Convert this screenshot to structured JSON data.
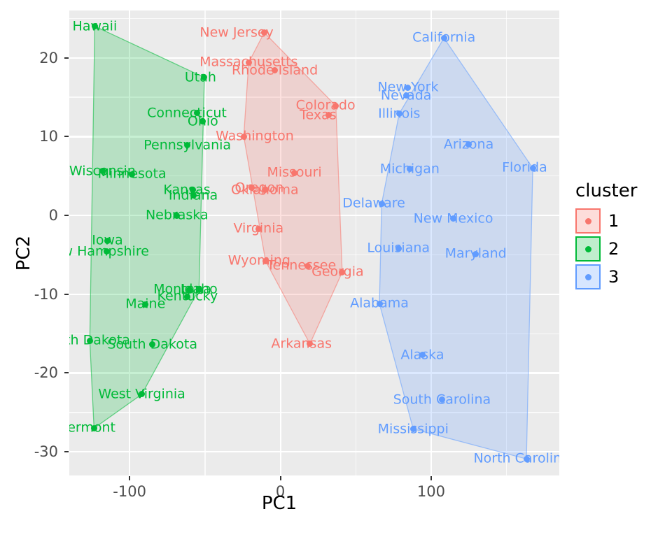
{
  "chart_data": {
    "type": "scatter",
    "title": "",
    "xlabel": "PC1",
    "ylabel": "PC2",
    "xlim": [
      -140,
      185
    ],
    "ylim": [
      -33,
      26
    ],
    "xticks": [
      "-100",
      "0",
      "100"
    ],
    "xtick_values": [
      -100,
      0,
      100
    ],
    "yticks": [
      "-30",
      "-20",
      "-10",
      "0",
      "10",
      "20"
    ],
    "ytick_values": [
      -30,
      -20,
      -10,
      0,
      10,
      20
    ],
    "grid": true,
    "legend": {
      "title": "cluster",
      "position": "right",
      "entries": [
        {
          "label": "1",
          "color": "#F8766D"
        },
        {
          "label": "2",
          "color": "#00BA38"
        },
        {
          "label": "3",
          "color": "#619CFF"
        }
      ]
    },
    "series": [
      {
        "name": "1",
        "color": "#F8766D",
        "points": [
          {
            "label": "New Jersey",
            "x": -10.7,
            "y": 23.2,
            "lx": -29.0,
            "ly": 23.2
          },
          {
            "label": "Massachusetts",
            "x": -21.0,
            "y": 19.4,
            "lx": -21.0,
            "ly": 19.4
          },
          {
            "label": "Rhode Island",
            "x": -3.7,
            "y": 18.4,
            "lx": -3.7,
            "ly": 18.4
          },
          {
            "label": "Colorado",
            "x": 36.8,
            "y": 13.9,
            "lx": 30.0,
            "ly": 13.9
          },
          {
            "label": "Texas",
            "x": 32.2,
            "y": 12.7,
            "lx": 25.0,
            "ly": 12.7
          },
          {
            "label": "Washington",
            "x": -24.3,
            "y": 10.0,
            "lx": -17.0,
            "ly": 10.0
          },
          {
            "label": "Missouri",
            "x": 9.3,
            "y": 5.4,
            "lx": 9.3,
            "ly": 5.4
          },
          {
            "label": "Oregon",
            "x": -19.1,
            "y": 3.5,
            "lx": -14.0,
            "ly": 3.5
          },
          {
            "label": "Oklahoma",
            "x": -10.3,
            "y": 3.2,
            "lx": -10.3,
            "ly": 3.2
          },
          {
            "label": "Virginia",
            "x": -14.5,
            "y": -1.7,
            "lx": -14.5,
            "ly": -1.7
          },
          {
            "label": "Wyoming",
            "x": -9.8,
            "y": -5.8,
            "lx": -14.0,
            "ly": -5.8
          },
          {
            "label": "Tennessee",
            "x": 18.2,
            "y": -6.4,
            "lx": 14.0,
            "ly": -6.4
          },
          {
            "label": "Georgia",
            "x": 41.0,
            "y": -7.2,
            "lx": 38.0,
            "ly": -7.2
          },
          {
            "label": "Arkansas",
            "x": 19.6,
            "y": -16.3,
            "lx": 14.0,
            "ly": -16.3
          }
        ],
        "hull": [
          [
            -10.7,
            23.2
          ],
          [
            36.8,
            13.9
          ],
          [
            41.0,
            -7.2
          ],
          [
            19.6,
            -16.3
          ],
          [
            -9.8,
            -5.8
          ],
          [
            -24.3,
            10.0
          ],
          [
            -21.0,
            19.4
          ]
        ]
      },
      {
        "name": "2",
        "color": "#00BA38",
        "points": [
          {
            "label": "Hawaii",
            "x": -123.1,
            "y": 24.0,
            "lx": -123.1,
            "ly": 24.0
          },
          {
            "label": "Utah",
            "x": -50.4,
            "y": 17.5,
            "lx": -53.0,
            "ly": 17.5
          },
          {
            "label": "Connecticut",
            "x": -55.5,
            "y": 13.0,
            "lx": -62.0,
            "ly": 13.0
          },
          {
            "label": "Ohio",
            "x": -51.4,
            "y": 11.9,
            "lx": -51.4,
            "ly": 11.9
          },
          {
            "label": "Pennsylvania",
            "x": -61.7,
            "y": 8.9,
            "lx": -61.7,
            "ly": 8.9
          },
          {
            "label": "Wisconsin",
            "x": -118.0,
            "y": 5.6,
            "lx": -118.0,
            "ly": 5.6
          },
          {
            "label": "Minnesota",
            "x": -98.4,
            "y": 5.2,
            "lx": -98.4,
            "ly": 5.2
          },
          {
            "label": "Kansas",
            "x": -58.0,
            "y": 3.2,
            "lx": -62.0,
            "ly": 3.2
          },
          {
            "label": "Indiana",
            "x": -57.8,
            "y": 2.5,
            "lx": -57.8,
            "ly": 2.5
          },
          {
            "label": "Nebraska",
            "x": -68.6,
            "y": 0.0,
            "lx": -68.6,
            "ly": 0.0
          },
          {
            "label": "Iowa",
            "x": -114.7,
            "y": -3.2,
            "lx": -114.7,
            "ly": -3.2
          },
          {
            "label": "New Hampshire",
            "x": -115.2,
            "y": -4.6,
            "lx": -122.0,
            "ly": -4.6
          },
          {
            "label": "Montana",
            "x": -60.2,
            "y": -9.4,
            "lx": -65.0,
            "ly": -9.4
          },
          {
            "label": "Idaho",
            "x": -54.0,
            "y": -9.4,
            "lx": -54.0,
            "ly": -9.4
          },
          {
            "label": "Kentucky",
            "x": -61.6,
            "y": -10.3,
            "lx": -61.6,
            "ly": -10.3
          },
          {
            "label": "Maine",
            "x": -89.5,
            "y": -11.3,
            "lx": -89.5,
            "ly": -11.3
          },
          {
            "label": "North Dakota",
            "x": -126.4,
            "y": -15.9,
            "lx": -129.0,
            "ly": -15.9
          },
          {
            "label": "South Dakota",
            "x": -84.9,
            "y": -16.4,
            "lx": -84.9,
            "ly": -16.4
          },
          {
            "label": "West Virginia",
            "x": -91.9,
            "y": -22.7,
            "lx": -91.9,
            "ly": -22.7
          },
          {
            "label": "Vermont",
            "x": -123.6,
            "y": -27.0,
            "lx": -128.0,
            "ly": -27.0
          }
        ],
        "hull": [
          [
            -123.1,
            24.0
          ],
          [
            -50.4,
            17.5
          ],
          [
            -54.0,
            -9.4
          ],
          [
            -91.9,
            -22.7
          ],
          [
            -123.6,
            -27.0
          ],
          [
            -126.4,
            -15.9
          ]
        ]
      },
      {
        "name": "3",
        "color": "#619CFF",
        "points": [
          {
            "label": "California",
            "x": 108.5,
            "y": 22.5,
            "lx": 108.5,
            "ly": 22.5
          },
          {
            "label": "New York",
            "x": 84.7,
            "y": 16.2,
            "lx": 84.7,
            "ly": 16.2
          },
          {
            "label": "Nevada",
            "x": 83.4,
            "y": 15.2,
            "lx": 83.4,
            "ly": 15.2
          },
          {
            "label": "Illinois",
            "x": 78.8,
            "y": 12.9,
            "lx": 78.8,
            "ly": 12.9
          },
          {
            "label": "Arizona",
            "x": 124.9,
            "y": 9.0,
            "lx": 124.9,
            "ly": 9.0
          },
          {
            "label": "Florida",
            "x": 167.4,
            "y": 6.0,
            "lx": 162.0,
            "ly": 6.0
          },
          {
            "label": "Michigan",
            "x": 85.8,
            "y": 5.9,
            "lx": 85.8,
            "ly": 5.9
          },
          {
            "label": "Delaware",
            "x": 67.2,
            "y": 1.5,
            "lx": 62.0,
            "ly": 1.5
          },
          {
            "label": "New Mexico",
            "x": 114.7,
            "y": -0.4,
            "lx": 114.7,
            "ly": -0.4
          },
          {
            "label": "Louisiana",
            "x": 78.3,
            "y": -4.2,
            "lx": 78.3,
            "ly": -4.2
          },
          {
            "label": "Maryland",
            "x": 129.6,
            "y": -4.9,
            "lx": 129.6,
            "ly": -4.9
          },
          {
            "label": "Alabama",
            "x": 65.7,
            "y": -11.2,
            "lx": 65.7,
            "ly": -11.2
          },
          {
            "label": "Alaska",
            "x": 94.2,
            "y": -17.7,
            "lx": 94.2,
            "ly": -17.7
          },
          {
            "label": "South Carolina",
            "x": 107.2,
            "y": -23.4,
            "lx": 107.2,
            "ly": -23.4
          },
          {
            "label": "Mississippi",
            "x": 88.1,
            "y": -27.1,
            "lx": 88.1,
            "ly": -27.1
          },
          {
            "label": "North Carolina",
            "x": 163.2,
            "y": -30.9,
            "lx": 160.0,
            "ly": -30.9
          }
        ],
        "hull": [
          [
            108.5,
            22.5
          ],
          [
            167.4,
            6.0
          ],
          [
            163.2,
            -30.9
          ],
          [
            88.1,
            -27.1
          ],
          [
            65.7,
            -11.2
          ],
          [
            67.2,
            1.5
          ],
          [
            78.8,
            12.9
          ]
        ]
      }
    ]
  }
}
